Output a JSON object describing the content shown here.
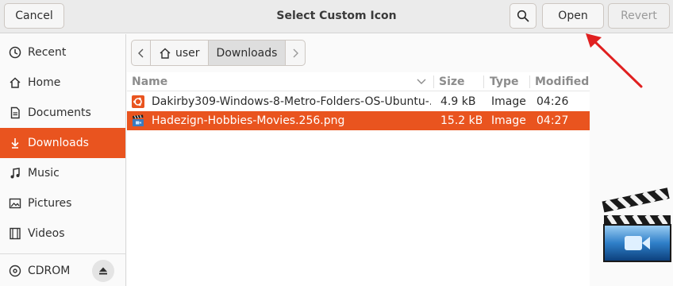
{
  "header": {
    "title": "Select Custom Icon",
    "cancel_label": "Cancel",
    "open_label": "Open",
    "revert_label": "Revert"
  },
  "sidebar": {
    "items": [
      {
        "label": "Recent",
        "icon": "clock-icon"
      },
      {
        "label": "Home",
        "icon": "home-icon"
      },
      {
        "label": "Documents",
        "icon": "document-icon"
      },
      {
        "label": "Downloads",
        "icon": "download-icon",
        "active": true
      },
      {
        "label": "Music",
        "icon": "music-note-icon"
      },
      {
        "label": "Pictures",
        "icon": "picture-icon"
      },
      {
        "label": "Videos",
        "icon": "film-icon"
      }
    ],
    "devices": [
      {
        "label": "CDROM",
        "icon": "disc-icon"
      }
    ]
  },
  "pathbar": {
    "segments": [
      "user",
      "Downloads"
    ]
  },
  "file_list": {
    "columns": {
      "name": "Name",
      "size": "Size",
      "type": "Type",
      "modified": "Modified"
    },
    "rows": [
      {
        "name": "Dakirby309-Windows-8-Metro-Folders-OS-Ubuntu-...",
        "size": "4.9 kB",
        "type": "Image",
        "modified": "04:26",
        "icon": "ubuntu-image-icon"
      },
      {
        "name": "Hadezign-Hobbies-Movies.256.png",
        "size": "15.2 kB",
        "type": "Image",
        "modified": "04:27",
        "icon": "clapperboard-image-icon",
        "selected": true
      }
    ]
  },
  "colors": {
    "accent": "#e9541f",
    "annotation_arrow": "#e02020"
  }
}
